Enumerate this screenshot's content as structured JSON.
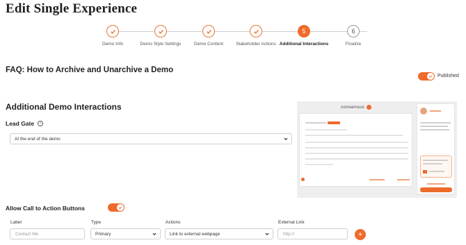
{
  "page": {
    "title": "Edit Single Experience"
  },
  "stepper": {
    "steps": [
      {
        "label": "Demo Info",
        "state": "done"
      },
      {
        "label": "Demo Style Settings",
        "state": "done"
      },
      {
        "label": "Demo Content",
        "state": "done"
      },
      {
        "label": "Stakeholder Actions",
        "state": "done"
      },
      {
        "label": "Additional Interactions",
        "state": "active",
        "number": "5"
      },
      {
        "label": "Finalize",
        "state": "todo",
        "number": "6"
      }
    ]
  },
  "demo": {
    "title": "FAQ: How to Archive and Unarchive a Demo",
    "published_label": "Published",
    "published": true
  },
  "interactions": {
    "section_title": "Additional Demo Interactions",
    "lead_gate": {
      "label": "Lead Gate",
      "value": "At the end of the demo"
    },
    "cta": {
      "label": "Allow Call to Action Buttons",
      "enabled": true,
      "columns": {
        "label": "Label",
        "type": "Type",
        "actions": "Actions",
        "external_link": "External Link"
      },
      "row": {
        "label_placeholder": "Contact Me",
        "type_value": "Primary",
        "actions_value": "Link to external webpage",
        "link_placeholder": "http://"
      },
      "add_symbol": "+"
    }
  },
  "preview": {
    "logo_text": "consensus"
  },
  "colors": {
    "accent": "#ee6b2b",
    "check": "#e9772d"
  },
  "icons": {
    "done_step": "check-icon",
    "info": "info-icon",
    "dropdown": "chevron-down-icon",
    "add": "plus-icon"
  }
}
